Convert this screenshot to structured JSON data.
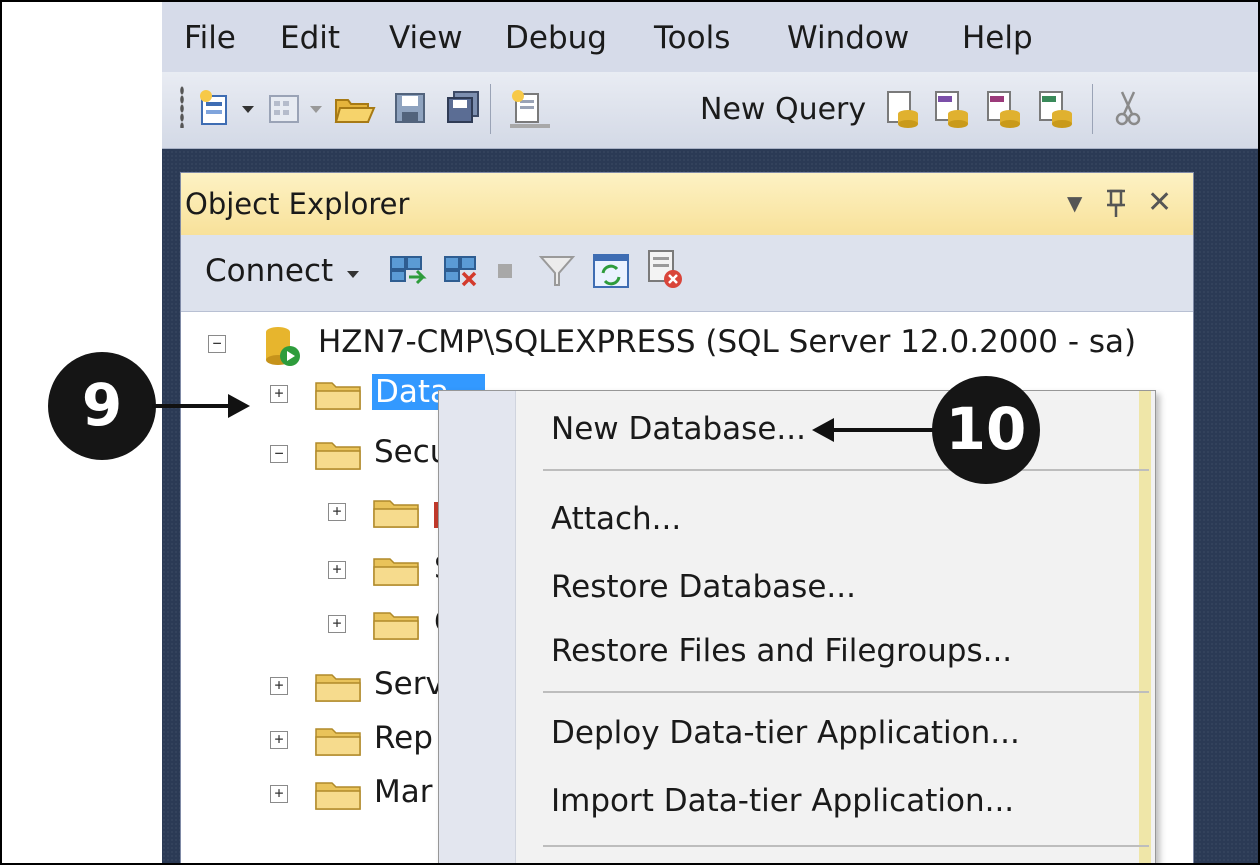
{
  "menubar": {
    "items": [
      "File",
      "Edit",
      "View",
      "Debug",
      "Tools",
      "Window",
      "Help"
    ]
  },
  "toolbar": {
    "new_query_label": "New Query",
    "icons": [
      "new-project-icon",
      "add-item-icon",
      "open-file-icon",
      "save-icon",
      "save-all-icon",
      "new-query-icon",
      "database-engine-query-icon",
      "mdx-query-icon",
      "dmx-query-icon",
      "xmla-query-icon",
      "cut-icon"
    ]
  },
  "object_explorer": {
    "title": "Object Explorer",
    "controls": {
      "dropdown": "▼",
      "pin": "ꟷ",
      "close": "✕"
    },
    "toolbar": {
      "connect_label": "Connect",
      "icons": [
        "connect-icon",
        "disconnect-icon",
        "stop-icon",
        "filter-icon",
        "refresh-icon",
        "activity-monitor-icon"
      ]
    },
    "tree": {
      "server_label": "HZN7-CMP\\SQLEXPRESS (SQL Server 12.0.2000 - sa)",
      "nodes": {
        "databases": "Data",
        "security": "Secu",
        "security_child_2": "S",
        "security_child_3": "C",
        "server_objects": "Serv",
        "replication": "Rep",
        "management": "Mar"
      }
    }
  },
  "context_menu": {
    "items": [
      "New Database...",
      "Attach...",
      "Restore Database...",
      "Restore Files and Filegroups...",
      "Deploy Data-tier Application...",
      "Import Data-tier Application..."
    ]
  },
  "callouts": {
    "step_9": "9",
    "step_10": "10"
  },
  "colors": {
    "selection": "#3399ff",
    "panel_title": "#f8e19a",
    "ide_background": "#2b3a55",
    "callout": "#151515"
  }
}
